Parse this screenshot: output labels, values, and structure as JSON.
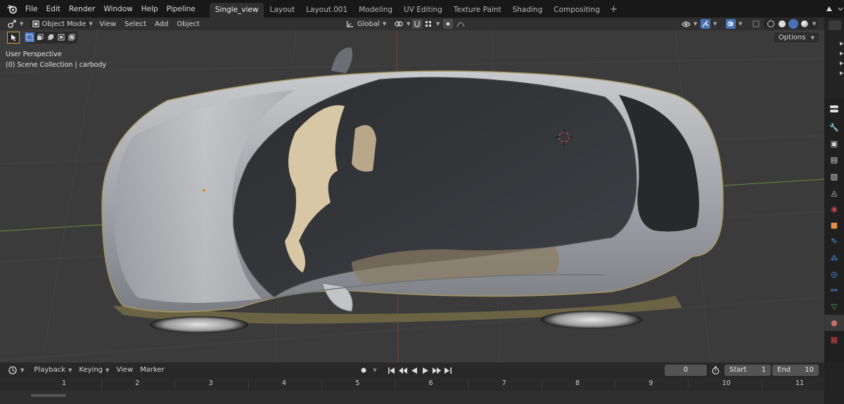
{
  "menu": [
    "File",
    "Edit",
    "Render",
    "Window",
    "Help",
    "Pipeline"
  ],
  "workspace_tabs": [
    {
      "label": "Single_view",
      "active": true
    },
    {
      "label": "Layout",
      "active": false
    },
    {
      "label": "Layout.001",
      "active": false
    },
    {
      "label": "Modeling",
      "active": false
    },
    {
      "label": "UV Editing",
      "active": false
    },
    {
      "label": "Texture Paint",
      "active": false
    },
    {
      "label": "Shading",
      "active": false
    },
    {
      "label": "Compositing",
      "active": false
    }
  ],
  "add_tab_label": "+",
  "viewport_header": {
    "mode": "Object Mode",
    "menus": [
      "View",
      "Select",
      "Add",
      "Object"
    ],
    "transform_orientation": "Global"
  },
  "viewport": {
    "perspective": "User Perspective",
    "collection": "(0) Scene Collection | carbody",
    "options_label": "Options"
  },
  "timeline": {
    "menus": [
      "Playback",
      "Keying",
      "View",
      "Marker"
    ],
    "current_frame": "0",
    "start_label": "Start",
    "start_value": "1",
    "end_label": "End",
    "end_value": "10",
    "ruler": [
      "1",
      "2",
      "3",
      "4",
      "5",
      "6",
      "7",
      "8",
      "9",
      "10",
      "11"
    ]
  },
  "colors": {
    "accent": "#4772b3",
    "car_body": "#a9acb1",
    "interior": "#d9c9a8",
    "grid": "#474747"
  },
  "icons": {
    "logo": "blender-logo-icon",
    "editor": "editor-type-icon",
    "properties": [
      "tool-icon",
      "render-icon",
      "output-icon",
      "view-layer-icon",
      "scene-icon",
      "world-icon",
      "object-icon",
      "modifier-icon",
      "particles-icon",
      "physics-icon",
      "constraints-icon",
      "data-icon",
      "material-icon",
      "texture-icon"
    ]
  }
}
